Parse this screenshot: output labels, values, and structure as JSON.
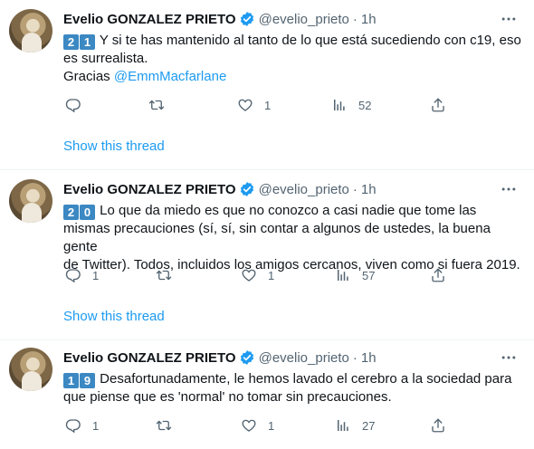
{
  "tweets": [
    {
      "name": "Evelio GONZALEZ PRIETO",
      "handle": "@evelio_prieto",
      "separator": "·",
      "time": "1h",
      "keycap_1": "2",
      "keycap_2": "1",
      "text_line1": "Y si te has mantenido al tanto de lo que está sucediendo con c19, eso",
      "text_line2": "es surrealista.",
      "text_line3_prefix": "Gracias ",
      "mention": "@EmmMacfarlane",
      "replies": "",
      "retweets": "",
      "likes": "1",
      "views": "52",
      "show_thread": "Show this thread"
    },
    {
      "name": "Evelio GONZALEZ PRIETO",
      "handle": "@evelio_prieto",
      "separator": "·",
      "time": "1h",
      "keycap_1": "2",
      "keycap_2": "0",
      "text_line1": "Lo que da miedo es que no conozco a casi nadie que tome las",
      "text_line2": "mismas precauciones (sí, sí, sin contar a algunos de ustedes, la buena gente",
      "text_line3": "de Twitter). Todos, incluidos los amigos cercanos, viven como si fuera 2019.",
      "replies": "1",
      "retweets": "",
      "likes": "1",
      "views": "57",
      "show_thread": "Show this thread"
    },
    {
      "name": "Evelio GONZALEZ PRIETO",
      "handle": "@evelio_prieto",
      "separator": "·",
      "time": "1h",
      "keycap_1": "1",
      "keycap_2": "9",
      "text_line1": "Desafortunadamente, le hemos lavado el cerebro a la sociedad para",
      "text_line2": "que piense que es  'normal' no tomar sin precauciones.",
      "replies": "1",
      "retweets": "",
      "likes": "1",
      "views": "27"
    }
  ],
  "icons": {
    "reply": "reply-icon",
    "retweet": "retweet-icon",
    "like": "heart-icon",
    "views": "views-icon",
    "share": "share-icon",
    "more": "more-icon",
    "verified": "verified-badge-icon"
  },
  "colors": {
    "accent": "#1d9bf0",
    "text": "#0f1419",
    "muted": "#536471",
    "keycap": "#3b88c3"
  }
}
